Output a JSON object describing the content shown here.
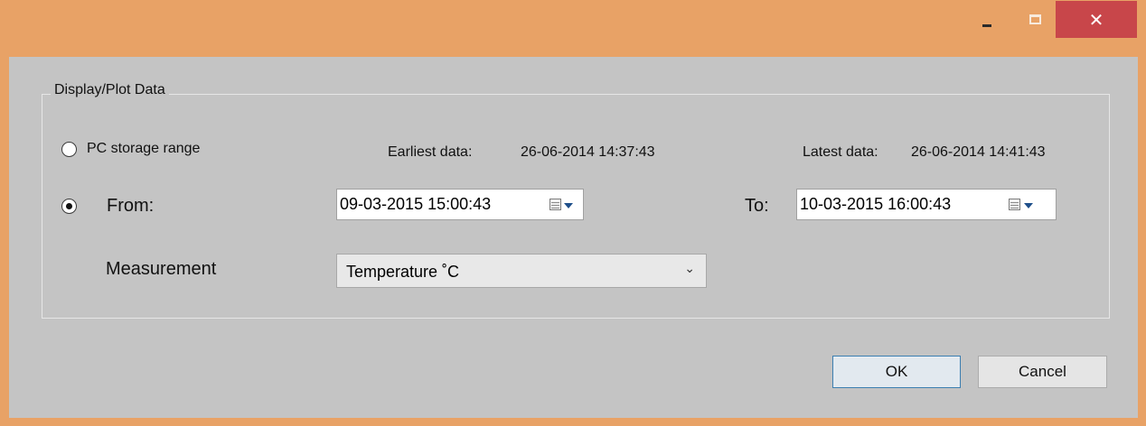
{
  "window": {
    "controls": {
      "minimize_icon": "minimize-icon",
      "maximize_icon": "maximize-icon",
      "close_icon": "close-icon",
      "close_glyph": "✕"
    },
    "colors": {
      "frame": "#e8a266",
      "client": "#c4c4c4",
      "close_button": "#c8464a"
    }
  },
  "group": {
    "title": "Display/Plot Data"
  },
  "range": {
    "pc_storage_label": "PC storage range",
    "pc_storage_selected": false,
    "earliest_label": "Earliest data:",
    "earliest_value": "26-06-2014 14:37:43",
    "latest_label": "Latest data:",
    "latest_value": "26-06-2014 14:41:43",
    "from_label": "From:",
    "from_selected": true,
    "from_value": "09-03-2015 15:00:43",
    "to_label": "To:",
    "to_value": "10-03-2015 16:00:43"
  },
  "measurement": {
    "label": "Measurement",
    "selected": "Temperature ˚C"
  },
  "buttons": {
    "ok": "OK",
    "cancel": "Cancel"
  }
}
